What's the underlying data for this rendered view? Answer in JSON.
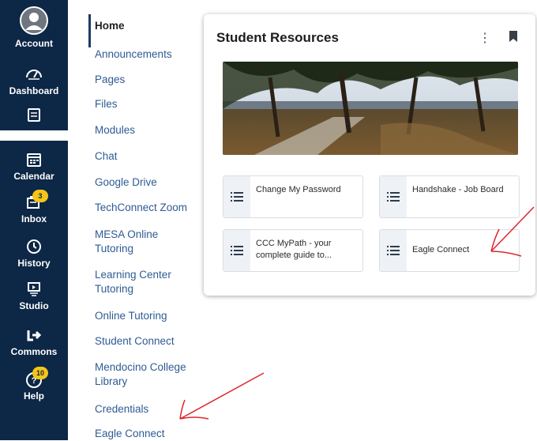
{
  "global_nav": {
    "items": [
      {
        "key": "account",
        "label": "Account"
      },
      {
        "key": "dashboard",
        "label": "Dashboard"
      },
      {
        "key": "courses",
        "label": ""
      },
      {
        "key": "calendar",
        "label": "Calendar"
      },
      {
        "key": "inbox",
        "label": "Inbox",
        "badge": "3"
      },
      {
        "key": "history",
        "label": "History"
      },
      {
        "key": "studio",
        "label": "Studio"
      },
      {
        "key": "commons",
        "label": "Commons"
      },
      {
        "key": "help",
        "label": "Help",
        "badge": "10"
      }
    ]
  },
  "course_nav": {
    "items": [
      "Home",
      "Announcements",
      "Pages",
      "Files",
      "Modules",
      "Chat",
      "Google Drive",
      "TechConnect Zoom",
      "MESA Online Tutoring",
      "Learning Center Tutoring",
      "Online Tutoring",
      "Student Connect",
      "Mendocino College Library",
      "Credentials",
      "Eagle Connect"
    ]
  },
  "card": {
    "title": "Student Resources",
    "kebab": "⋮",
    "tiles": [
      {
        "label": "Change My Password"
      },
      {
        "label": "Handshake - Job Board"
      },
      {
        "label": "CCC MyPath - your complete guide to..."
      },
      {
        "label": "Eagle Connect"
      }
    ]
  },
  "colors": {
    "nav_bg": "#0d2746",
    "badge": "#f5c518",
    "link": "#2e5b93",
    "annotation_arrow": "#e0242b"
  }
}
